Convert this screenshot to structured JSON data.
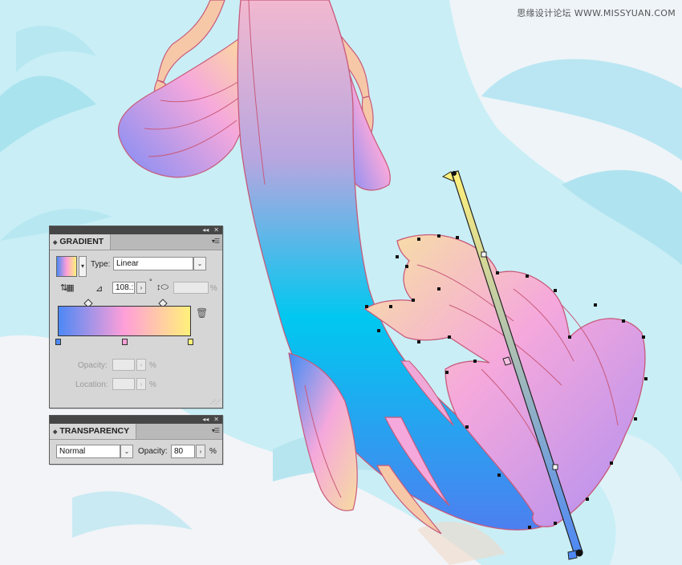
{
  "watermark": "思缘设计论坛 WWW.MISSYUAN.COM",
  "gradient_panel": {
    "tab_label": "GRADIENT",
    "type_label": "Type:",
    "type_value": "Linear",
    "angle_value": "108.:",
    "aspect_unit": "%",
    "opacity_label": "Opacity:",
    "opacity_unit": "%",
    "location_label": "Location:",
    "location_unit": "%",
    "stops": [
      {
        "color": "#4d88f5",
        "location": 0
      },
      {
        "color": "#ff9fd8",
        "location": 50
      },
      {
        "color": "#fff07a",
        "location": 100
      }
    ]
  },
  "transparency_panel": {
    "tab_label": "TRANSPARENCY",
    "blend_mode": "Normal",
    "opacity_label": "Opacity:",
    "opacity_value": "80",
    "opacity_unit": "%"
  },
  "colors": {
    "panel_bg": "#d6d6d6",
    "panel_titlebar": "#464646",
    "tail_blue": "#3f8cf5",
    "tail_cyan": "#00c8f0",
    "fin_pink": "#f5a8dc",
    "fin_yellow": "#f7dca0",
    "outline": "#c85a7a"
  }
}
